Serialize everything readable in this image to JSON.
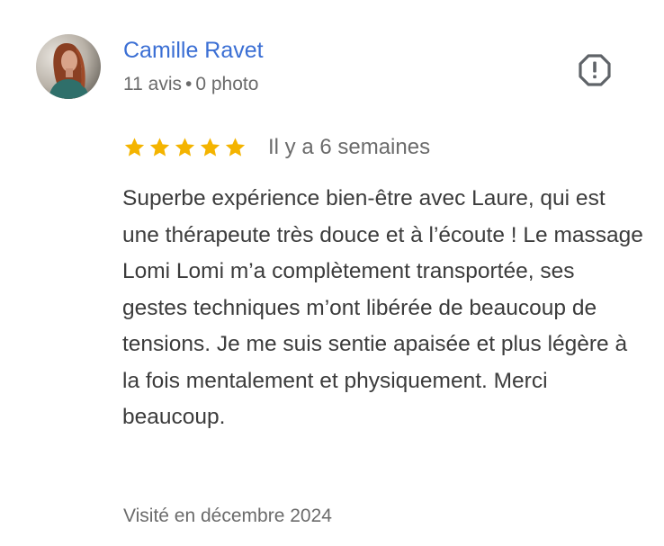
{
  "review": {
    "author": {
      "name": "Camille Ravet",
      "reviews_count": "11 avis",
      "separator": "•",
      "photos_count": "0 photo",
      "avatar_icon": "avatar-photo"
    },
    "report_icon": "alert-octagon-icon",
    "rating": {
      "stars": 5,
      "max_stars": 5,
      "star_color": "#f4b400"
    },
    "date": "Il y a 6 semaines",
    "text": "Superbe expérience bien-être avec Laure, qui est une thérapeute très douce et à l’écoute ! Le massage Lomi Lomi m’a complètement transportée, ses gestes techniques m’ont libérée de beaucoup de tensions. Je me suis sentie apaisée et plus légère à la fois mentalement et physiquement. Merci beaucoup.",
    "visit_date": "Visité en décembre 2024"
  },
  "colors": {
    "author_name": "#3b6fd4",
    "muted_text": "#6b6b6b",
    "body_text": "#3c3c3c"
  }
}
